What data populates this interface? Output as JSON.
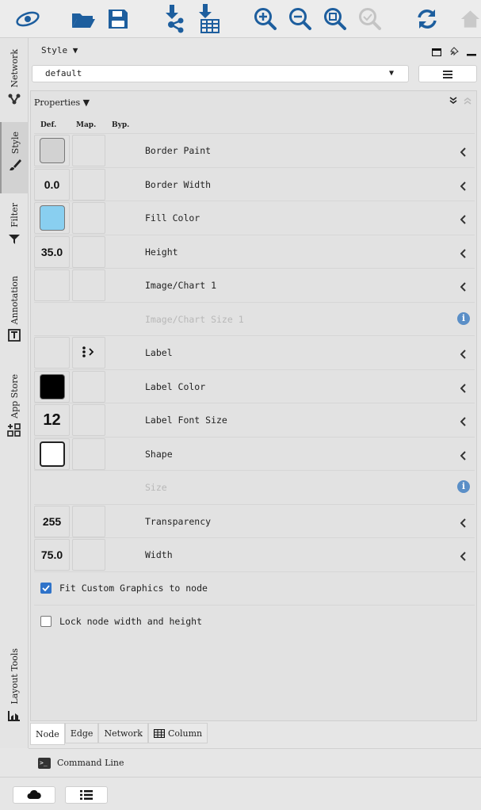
{
  "toolbar": {
    "icons": [
      "cytoscape-logo-icon",
      "open-folder-icon",
      "save-icon",
      "import-network-icon",
      "import-table-icon",
      "zoom-in-icon",
      "zoom-out-icon",
      "zoom-fit-icon",
      "zoom-selected-icon",
      "refresh-icon",
      "home-icon"
    ]
  },
  "side_tabs": [
    {
      "label": "Network",
      "icon": "network-icon"
    },
    {
      "label": "Style",
      "icon": "brush-icon"
    },
    {
      "label": "Filter",
      "icon": "filter-icon"
    },
    {
      "label": "Annotation",
      "icon": "annotation-icon"
    },
    {
      "label": "App Store",
      "icon": "app-store-icon"
    },
    {
      "label": "Layout Tools",
      "icon": "layout-tools-icon"
    }
  ],
  "style_panel": {
    "title": "Style ▼",
    "selected_style": "default"
  },
  "properties": {
    "title": "Properties ▼",
    "columns": {
      "def": "Def.",
      "map": "Map.",
      "byp": "Byp."
    },
    "rows": [
      {
        "label": "Border Paint",
        "def_type": "swatch",
        "def_color": "#d2d2d2",
        "def_value": "",
        "map": "",
        "disabled": false,
        "trail": "arrow"
      },
      {
        "label": "Border Width",
        "def_type": "num",
        "def_value": "0.0",
        "map": "",
        "disabled": false,
        "trail": "arrow"
      },
      {
        "label": "Fill Color",
        "def_type": "swatch",
        "def_color": "#89cff0",
        "def_value": "",
        "map": "",
        "disabled": false,
        "trail": "arrow"
      },
      {
        "label": "Height",
        "def_type": "num",
        "def_value": "35.0",
        "map": "",
        "disabled": false,
        "trail": "arrow"
      },
      {
        "label": "Image/Chart 1",
        "def_type": "empty",
        "def_value": "",
        "map": "",
        "disabled": false,
        "trail": "arrow"
      },
      {
        "label": "Image/Chart Size 1",
        "def_type": "none",
        "def_value": "",
        "map": "",
        "disabled": true,
        "trail": "info"
      },
      {
        "label": "Label",
        "def_type": "empty",
        "def_value": "",
        "map": "mapping-icon",
        "disabled": false,
        "trail": "arrow"
      },
      {
        "label": "Label Color",
        "def_type": "swatch",
        "def_color": "#000000",
        "def_value": "",
        "map": "",
        "disabled": false,
        "trail": "arrow"
      },
      {
        "label": "Label Font Size",
        "def_type": "bignum",
        "def_value": "12",
        "map": "",
        "disabled": false,
        "trail": "arrow"
      },
      {
        "label": "Shape",
        "def_type": "shape",
        "def_value": "",
        "map": "",
        "disabled": false,
        "trail": "arrow"
      },
      {
        "label": "Size",
        "def_type": "none",
        "def_value": "",
        "map": "",
        "disabled": true,
        "trail": "info"
      },
      {
        "label": "Transparency",
        "def_type": "num",
        "def_value": "255",
        "map": "",
        "disabled": false,
        "trail": "arrow"
      },
      {
        "label": "Width",
        "def_type": "num",
        "def_value": "75.0",
        "map": "",
        "disabled": false,
        "trail": "arrow"
      }
    ],
    "checkboxes": [
      {
        "label": "Fit Custom Graphics to node",
        "checked": true
      },
      {
        "label": "Lock node width and height",
        "checked": false
      }
    ]
  },
  "bottom_tabs": [
    {
      "label": "Node",
      "active": true
    },
    {
      "label": "Edge",
      "active": false
    },
    {
      "label": "Network",
      "active": false
    },
    {
      "label": "Column",
      "active": false,
      "icon": "table-icon"
    }
  ],
  "command_line": "Command Line",
  "info_glyph": "i",
  "colors": {
    "accent": "#2f73c9",
    "info": "#5b8fc7",
    "icon_blue": "#1d5e9e"
  }
}
